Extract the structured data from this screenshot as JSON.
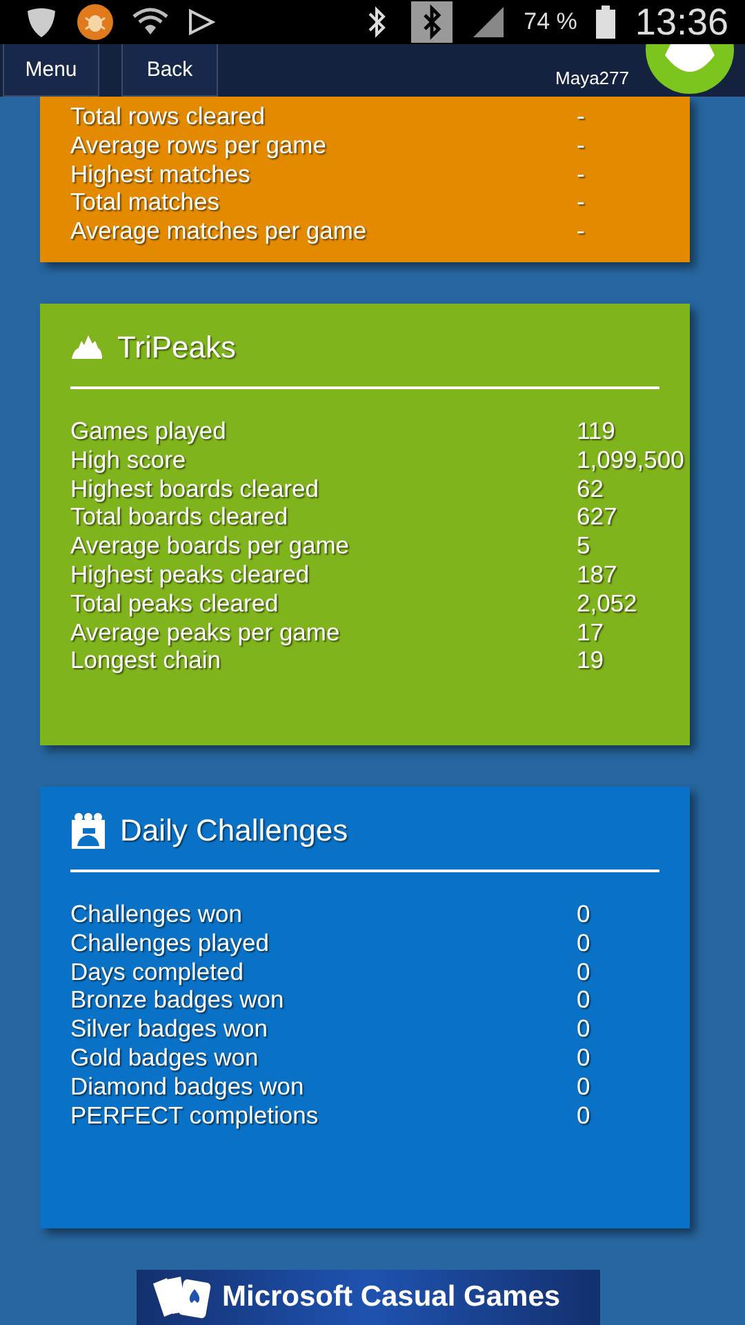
{
  "status_bar": {
    "battery": "74 %",
    "time": "13:36"
  },
  "nav": {
    "buttons": [
      "Menu",
      "Back"
    ],
    "username": "Maya277"
  },
  "sections": [
    {
      "color": "#e38a00",
      "rows": [
        {
          "label": "Total rows cleared",
          "value": "-"
        },
        {
          "label": "Average rows per game",
          "value": "-"
        },
        {
          "label": "Highest matches",
          "value": "-"
        },
        {
          "label": "Total matches",
          "value": "-"
        },
        {
          "label": "Average matches per game",
          "value": "-"
        }
      ]
    },
    {
      "kind": "peaks",
      "title": "TriPeaks",
      "color": "#80b41c",
      "rows": [
        {
          "label": "Games played",
          "value": "119"
        },
        {
          "label": "High score",
          "value": "1,099,500"
        },
        {
          "label": "Highest boards cleared",
          "value": "62"
        },
        {
          "label": "Total boards cleared",
          "value": "627"
        },
        {
          "label": "Average boards per game",
          "value": "5"
        },
        {
          "label": "Highest peaks cleared",
          "value": "187"
        },
        {
          "label": "Total peaks cleared",
          "value": "2,052"
        },
        {
          "label": "Average peaks per game",
          "value": "17"
        },
        {
          "label": "Longest chain",
          "value": "19"
        }
      ]
    },
    {
      "kind": "calendar",
      "title": "Daily Challenges",
      "color": "#0a72c6",
      "rows": [
        {
          "label": "Challenges won",
          "value": "0"
        },
        {
          "label": "Challenges played",
          "value": "0"
        },
        {
          "label": "Days completed",
          "value": "0"
        },
        {
          "label": "Bronze badges won",
          "value": "0"
        },
        {
          "label": "Silver badges won",
          "value": "0"
        },
        {
          "label": "Gold badges won",
          "value": "0"
        },
        {
          "label": "Diamond badges won",
          "value": "0"
        },
        {
          "label": "PERFECT completions",
          "value": "0"
        }
      ]
    }
  ],
  "footer": {
    "brand": "Microsoft Casual Games"
  }
}
